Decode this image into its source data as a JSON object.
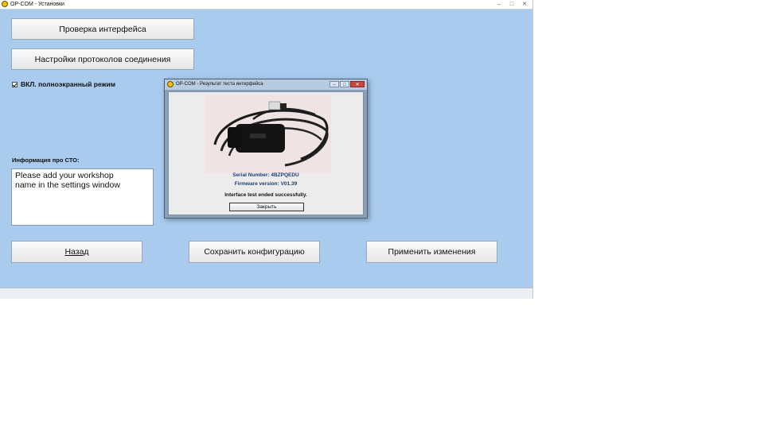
{
  "window": {
    "title": "OP-COM - Установки"
  },
  "buttons": {
    "interface_check": "Проверка интерфейса",
    "protocol_settings": "Настройки протоколов соединения",
    "back": "Назад",
    "save_config": "Сохранить конфигурацию",
    "apply_changes": "Применить изменения"
  },
  "fullscreen_checkbox": {
    "label": "ВКЛ. полноэкранный режим",
    "checked": true
  },
  "workshop_info": {
    "label": "Информация про СТО:",
    "value": "Please add your workshop\nname in the settings window"
  },
  "dialog": {
    "title": "OP-COM - Результат теста интерфейса",
    "serial": "Serial Number: 4BZPQEDU",
    "firmware": "Firmware version: V01.39",
    "result": "Interface test ended successfully.",
    "close_button": "Закрыть"
  },
  "colors": {
    "window_bg": "#a9cbee",
    "dialog_frame": "#8a9fb8",
    "serial_text": "#1f3e77"
  }
}
